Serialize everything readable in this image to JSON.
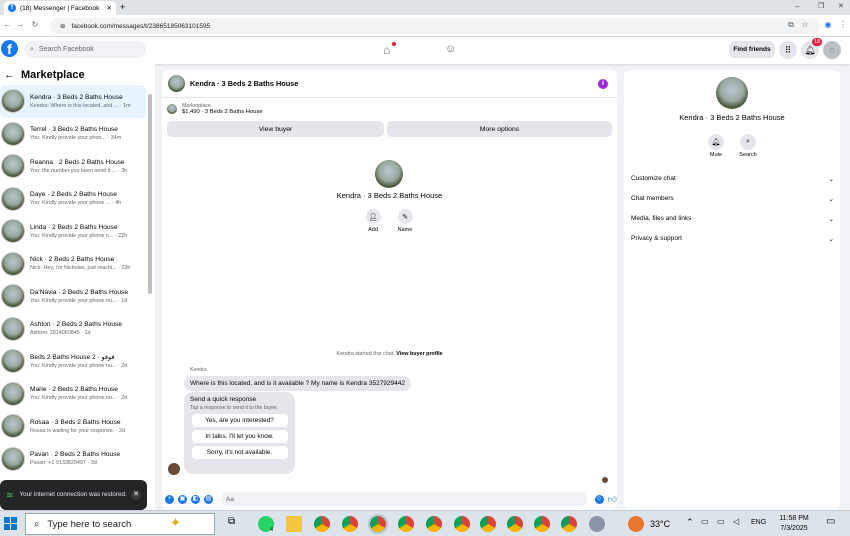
{
  "browser": {
    "tab_title": "(18) Messenger | Facebook",
    "url": "facebook.com/messages/t/23865185063101595"
  },
  "header": {
    "search_placeholder": "Search Facebook",
    "find_friends": "Find friends",
    "notif_badge": "18"
  },
  "sidebar": {
    "title": "Marketplace",
    "conversations": [
      {
        "name": "Kendra · 3 Beds 2 Baths House",
        "snippet": "Kendra: Where is this located, and ... · 1m"
      },
      {
        "name": "Terrel · 3 Beds 2 Baths House",
        "snippet": "You: Kindly provide your phon... · 34m"
      },
      {
        "name": "Reanna · 2 Beds 2 Baths House",
        "snippet": "You: the number you been send it ... · 3h"
      },
      {
        "name": "Daye · 2 Beds 2 Baths House",
        "snippet": "You: Kindly provide your phone ... · 4h"
      },
      {
        "name": "Linda · 2 Beds 2 Baths House",
        "snippet": "You: Kindly provide your phone n... · 22h"
      },
      {
        "name": "Nick · 2 Beds 2 Baths House",
        "snippet": "Nick: Hey, i'm Nicholas, just reachi... · 23h"
      },
      {
        "name": "Da'Navia · 2 Beds 2 Baths House",
        "snippet": "You: Kindly provide your phone nu... · 1d"
      },
      {
        "name": "Ashton · 2 Beds 2 Baths House",
        "snippet": "Ashton: 2814060845 · 1d"
      },
      {
        "name": "Beds 2 Baths House 2 · فوفو",
        "snippet": "You: Kindly provide your phone nu... · 2d"
      },
      {
        "name": "Marie · 2 Beds 2 Baths House",
        "snippet": "You: Kindly provide your phone nu... · 2d"
      },
      {
        "name": "Rosaa · 3 Beds 2 Baths House",
        "snippet": "Rosaa is waiting for your response. · 2d"
      },
      {
        "name": "Pavan · 2 Beds 2 Baths House",
        "snippet": "Pavan: +1 9133829497 · 3d"
      }
    ]
  },
  "toast": {
    "text": "Your internet connection was restored."
  },
  "chat": {
    "title": "Kendra · 3 Beds 2 Baths House",
    "listing_label": "Marketplace",
    "listing_detail": "$1,490 · 3 Beds 2 Baths House",
    "view_buyer": "View buyer",
    "more_options": "More options",
    "center_name": "Kendra · 3 Beds 2 Baths House",
    "add_label": "Add",
    "name_label": "Name",
    "started_text": "Kendra started this chat.",
    "view_profile": "View buyer profile",
    "sender": "Kendra",
    "message": "Where is this located, and is it available ? My name is Kendra 3527929442",
    "quick_title": "Send a quick response",
    "quick_sub": "Tap a response to send it to the buyer.",
    "quick_options": [
      "Yes, are you interested?",
      "In talks. I'll let you know.",
      "Sorry, it's not available."
    ],
    "composer_placeholder": "Aa"
  },
  "details": {
    "name": "Kendra · 3 Beds 2 Baths House",
    "mute": "Mute",
    "search": "Search",
    "sections": [
      "Customize chat",
      "Chat members",
      "Media, files and links",
      "Privacy & support"
    ]
  },
  "taskbar": {
    "search_placeholder": "Type here to search",
    "temperature": "33°C",
    "lang": "ENG",
    "time": "11:58 PM",
    "date": "7/3/2025",
    "badge": "4"
  },
  "colors": {
    "fb_blue": "#1877f2",
    "active_row": "#e7f3ff",
    "info_purple": "#9b2bd6"
  }
}
